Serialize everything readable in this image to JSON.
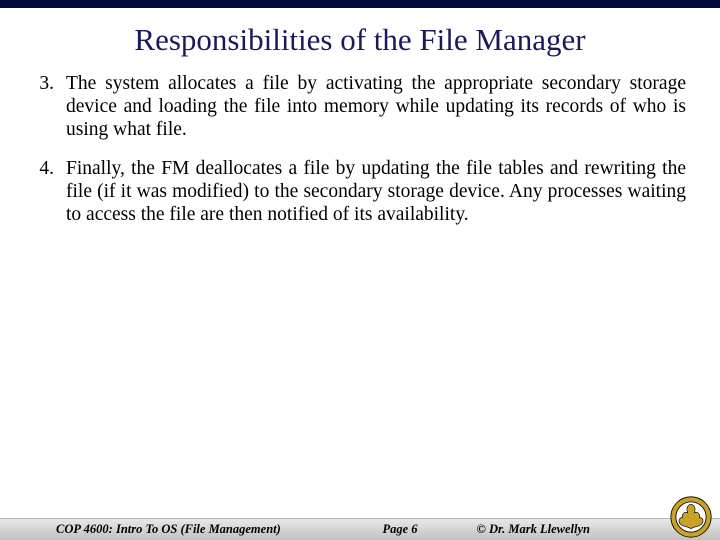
{
  "title": "Responsibilities of the File Manager",
  "items": [
    {
      "n": "3.",
      "text": "The system allocates a file by activating the appropriate secondary storage device and loading the file into memory while updating its records of who is using what file."
    },
    {
      "n": "4.",
      "text": "Finally, the FM deallocates a file by updating the file tables and rewriting the file (if it was modified) to the secondary storage device.  Any processes waiting to access the file are then notified of its availability."
    }
  ],
  "footer": {
    "left": "COP 4600: Intro To OS  (File Management)",
    "center": "Page 6",
    "right": "© Dr. Mark Llewellyn"
  }
}
